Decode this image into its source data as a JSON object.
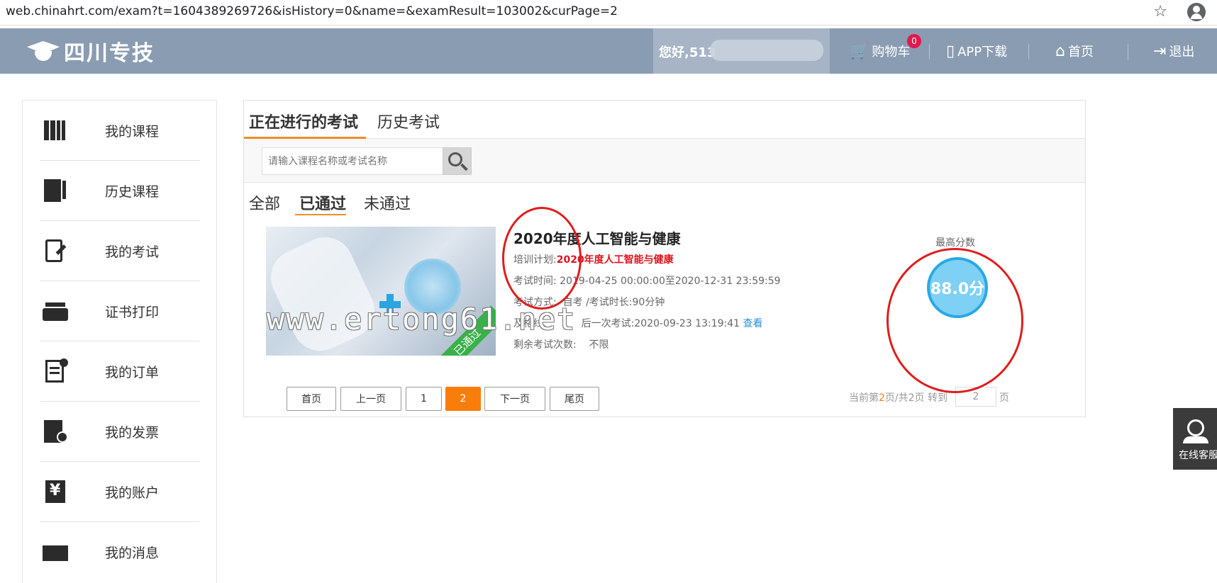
{
  "browser": {
    "url": "web.chinahrt.com/exam?t=1604389269726&isHistory=0&name=&examResult=103002&curPage=2"
  },
  "header": {
    "logo_text": "四川专技",
    "greeting": "您好,513",
    "cart_label": "购物车",
    "cart_count": "0",
    "app_label": "APP下载",
    "home_label": "首页",
    "logout_label": "退出"
  },
  "sidebar": {
    "items": [
      {
        "label": "我的课程",
        "icon": "books-icon"
      },
      {
        "label": "历史课程",
        "icon": "document-pen-icon"
      },
      {
        "label": "我的考试",
        "icon": "exam-edit-icon"
      },
      {
        "label": "证书打印",
        "icon": "printer-icon"
      },
      {
        "label": "我的订单",
        "icon": "order-clipboard-icon"
      },
      {
        "label": "我的发票",
        "icon": "invoice-icon"
      },
      {
        "label": "我的账户",
        "icon": "yen-account-icon"
      },
      {
        "label": "我的消息",
        "icon": "envelope-icon"
      }
    ]
  },
  "main": {
    "tabs": [
      "正在进行的考试",
      "历史考试"
    ],
    "search": {
      "placeholder": "请输入课程名称或考试名称"
    },
    "filters": [
      "全部",
      "已通过",
      "未通过"
    ],
    "exam": {
      "title": "2020年度人工智能与健康",
      "plan_label": "培训计划:",
      "plan_value": "2020年度人工智能与健康",
      "time_label": "考试时间:",
      "time_value": "2019-04-25 00:00:00至2020-12-31 23:59:59",
      "mode_label": "考试方式:",
      "mode_value": "自考 /考试时长:90分钟",
      "pass_label": "及格线:",
      "last_exam": "后一次考试:2020-09-23 13:19:41",
      "view_link": "查看",
      "remaining_label": "剩余考试次数:",
      "remaining_value": "不限",
      "badge": "已通过",
      "score_label": "最高分数",
      "score_value": "88.0分"
    },
    "watermark": "www.ertong61.net",
    "pager": {
      "buttons": [
        "首页",
        "上一页",
        "1",
        "2",
        "下一页",
        "尾页"
      ],
      "current_page": "2",
      "info_prefix": "当前第",
      "info_mid": "页/共2页 转到",
      "goto_value": "2",
      "goto_suffix": "页"
    }
  },
  "service": {
    "label": "在线客服"
  },
  "colors": {
    "header": "#8a9cb2",
    "accent": "#f97d0b",
    "annotation": "#e01d1d",
    "score": "#27a9e6"
  }
}
